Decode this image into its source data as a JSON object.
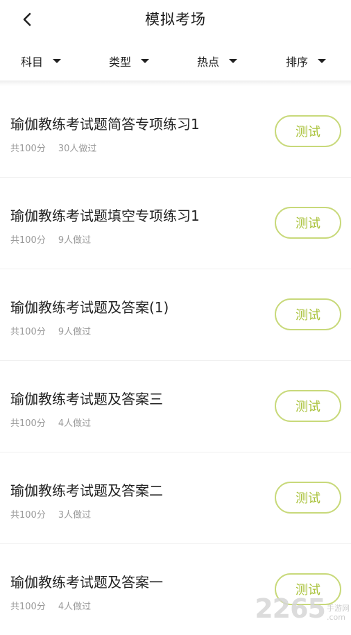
{
  "header": {
    "title": "模拟考场",
    "back_icon": "chevron-left-icon"
  },
  "filters": [
    {
      "label": "科目",
      "icon": "caret-down-icon"
    },
    {
      "label": "类型",
      "icon": "caret-down-icon"
    },
    {
      "label": "热点",
      "icon": "caret-down-icon"
    },
    {
      "label": "排序",
      "icon": "caret-down-icon"
    }
  ],
  "exams": [
    {
      "title": "瑜伽教练考试题简答专项练习1",
      "score": "共100分",
      "takers": "30人做过",
      "button": "测试"
    },
    {
      "title": "瑜伽教练考试题填空专项练习1",
      "score": "共100分",
      "takers": "9人做过",
      "button": "测试"
    },
    {
      "title": "瑜伽教练考试题及答案(1)",
      "score": "共100分",
      "takers": "9人做过",
      "button": "测试"
    },
    {
      "title": "瑜伽教练考试题及答案三",
      "score": "共100分",
      "takers": "4人做过",
      "button": "测试"
    },
    {
      "title": "瑜伽教练考试题及答案二",
      "score": "共100分",
      "takers": "3人做过",
      "button": "测试"
    },
    {
      "title": "瑜伽教练考试题及答案一",
      "score": "共100分",
      "takers": "4人做过",
      "button": "测试"
    }
  ],
  "watermark": {
    "number": "2265",
    "site_top": "手游网",
    "site_bottom": ".com"
  },
  "colors": {
    "accent": "#a9c23a",
    "accent_border": "#c8d97a",
    "meta_text": "#9a9a9a"
  }
}
